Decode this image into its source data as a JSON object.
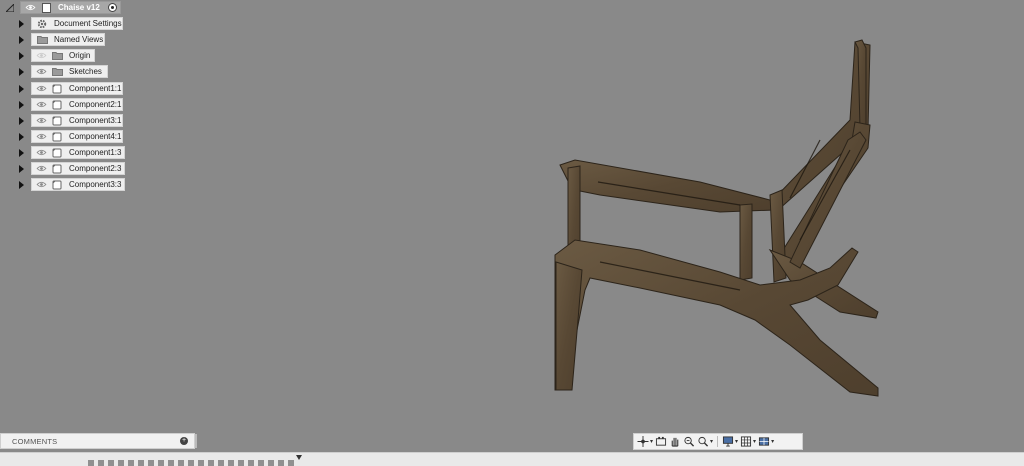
{
  "browser": {
    "root": {
      "label": "Chaise v12"
    },
    "items": [
      {
        "label": "Document Settings",
        "icon": "gear-icon",
        "eye": false
      },
      {
        "label": "Named Views",
        "icon": "folder-icon",
        "eye": false
      },
      {
        "label": "Origin",
        "icon": "folder-icon",
        "eye": "off"
      },
      {
        "label": "Sketches",
        "icon": "folder-icon",
        "eye": "on"
      },
      {
        "label": "Component1:1",
        "icon": "component-icon",
        "eye": "on"
      },
      {
        "label": "Component2:1",
        "icon": "component-icon",
        "eye": "on"
      },
      {
        "label": "Component3:1",
        "icon": "component-icon",
        "eye": "on"
      },
      {
        "label": "Component4:1",
        "icon": "component-icon",
        "eye": "on"
      },
      {
        "label": "Component1:3",
        "icon": "component-icon",
        "eye": "on"
      },
      {
        "label": "Component2:3",
        "icon": "component-icon",
        "eye": "on"
      },
      {
        "label": "Component3:3",
        "icon": "component-icon",
        "eye": "on"
      }
    ]
  },
  "comments": {
    "label": "COMMENTS"
  },
  "colors": {
    "viewport": "#898989",
    "wood": "#5a4a36",
    "panel": "#efefef"
  }
}
